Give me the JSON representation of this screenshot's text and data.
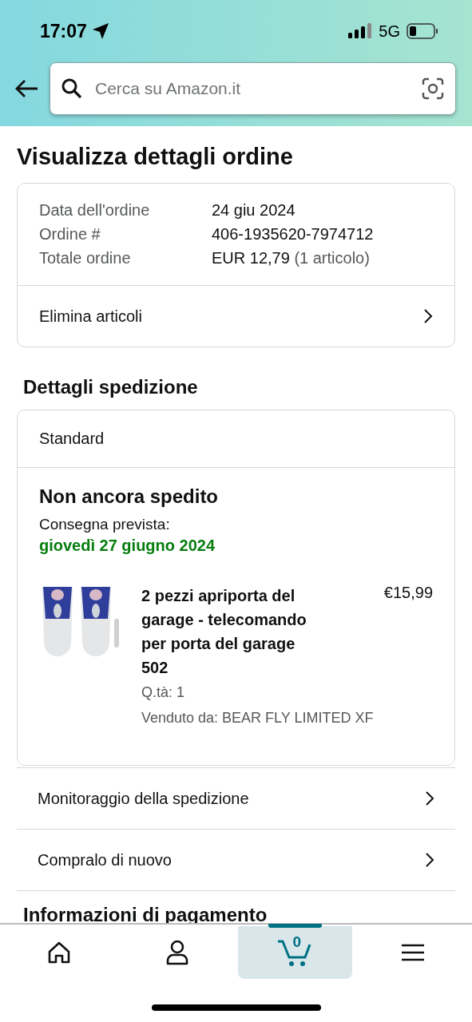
{
  "status_bar": {
    "time": "17:07",
    "network": "5G"
  },
  "search": {
    "placeholder": "Cerca su Amazon.it"
  },
  "title": "Visualizza dettagli ordine",
  "order_summary": {
    "rows": [
      {
        "label": "Data dell'ordine",
        "value": "24 giu 2024"
      },
      {
        "label": "Ordine #",
        "value": "406-1935620-7974712"
      },
      {
        "label": "Totale ordine",
        "value": "EUR 12,79",
        "note": "(1 articolo)"
      }
    ],
    "action": "Elimina articoli"
  },
  "shipment_heading": "Dettagli spedizione",
  "shipment": {
    "method": "Standard",
    "status": "Non ancora spedito",
    "delivery_label": "Consegna prevista:",
    "delivery_date": "giovedì 27 giugno 2024",
    "item": {
      "kind": "picture",
      "title": "2 pezzi apriporta del garage - telecomando per porta del garage 502",
      "price": "€15,99",
      "quantity": "Q.tà: 1",
      "seller": "Venduto da: BEAR FLY LIMITED XF"
    }
  },
  "links": [
    "Monitoraggio della spedizione",
    "Compralo di nuovo"
  ],
  "payment_heading": "Informazioni di pagamento",
  "nav": [
    {
      "kind": "home",
      "selected": false
    },
    {
      "kind": "account",
      "selected": false
    },
    {
      "kind": "cart",
      "selected": true,
      "count": "0"
    },
    {
      "kind": "menu",
      "selected": false
    }
  ]
}
